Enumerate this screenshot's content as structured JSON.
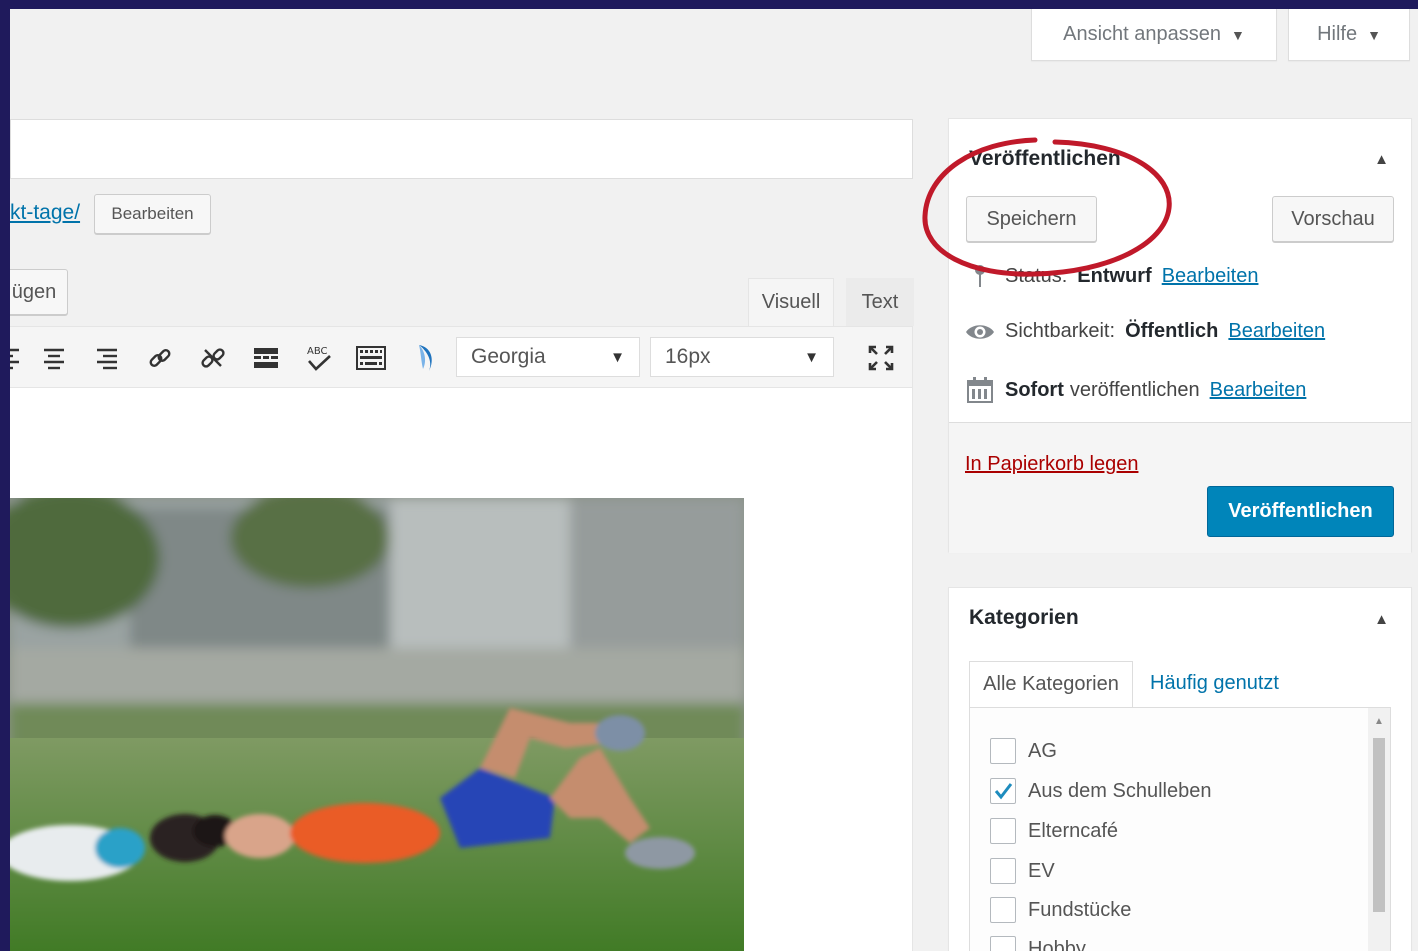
{
  "header": {
    "screen_options_label": "Ansicht anpassen",
    "help_label": "Hilfe"
  },
  "editor": {
    "permalink_fragment": "kt-tage/",
    "permalink_edit_label": "Bearbeiten",
    "media_button_partial": "ügen",
    "tabs": {
      "visual": "Visuell",
      "text": "Text"
    },
    "font_family": "Georgia",
    "font_size": "16px"
  },
  "publish_box": {
    "title": "Veröffentlichen",
    "save_label": "Speichern",
    "preview_label": "Vorschau",
    "status_label": "Status:",
    "status_value": "Entwurf",
    "visibility_label": "Sichtbarkeit:",
    "visibility_value": "Öffentlich",
    "schedule_value": "Sofort",
    "schedule_label": "veröffentlichen",
    "edit_link": "Bearbeiten",
    "trash_label": "In Papierkorb legen",
    "publish_label": "Veröffentlichen"
  },
  "categories_box": {
    "title": "Kategorien",
    "tab_all": "Alle Kategorien",
    "tab_popular": "Häufig genutzt",
    "items": [
      {
        "label": "AG",
        "checked": false
      },
      {
        "label": "Aus dem Schulleben",
        "checked": true
      },
      {
        "label": "Elterncafé",
        "checked": false
      },
      {
        "label": "EV",
        "checked": false
      },
      {
        "label": "Fundstücke",
        "checked": false
      },
      {
        "label": "Hobby",
        "checked": false
      }
    ]
  },
  "colors": {
    "accent": "#0085ba",
    "link": "#0073aa",
    "annotation": "#c0192a"
  }
}
